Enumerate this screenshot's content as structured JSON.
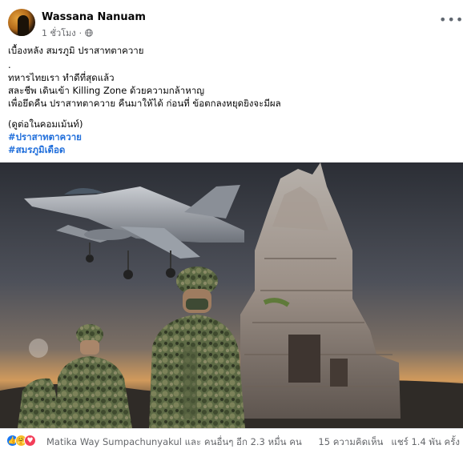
{
  "post": {
    "author": "Wassana Nanuam",
    "time": "1 ชั่วโมง",
    "separator": "·",
    "text_lines": [
      "เบื้องหลัง สมรภูมิ ปราสาทตาควาย",
      ".",
      "ทหารไทยเรา ทำดีที่สุดแล้ว",
      "สละชีพ เดินเข้า Killing Zone ด้วยความกล้าหาญ",
      "เพื่อยึดคืน ปราสาทตาควาย คืนมาให้ได้ ก่อนที่ ข้อตกลงหยุดยิงจะมีผล",
      "(ดูต่อในคอมเม้นท์)"
    ],
    "hashtags": [
      "#ปราสาทตาควาย",
      "#สมรภูมิเดือด"
    ]
  },
  "footer": {
    "reactors": "Matika Way Sumpachunyakul และ คนอื่นๆ อีก 2.3 หมื่น คน",
    "comments": "15 ความคิดเห็น",
    "shares": "แชร์ 1.4 พัน ครั้ง"
  },
  "icons": {
    "globe": "globe-icon",
    "more": "more-options-icon",
    "reactions": [
      "like-icon",
      "care-icon",
      "love-icon"
    ]
  },
  "colors": {
    "hashtag": "#216fdb",
    "meta_text": "#65676b",
    "like": "#1877f2",
    "love": "#f33e58",
    "care": "#f7b928"
  }
}
